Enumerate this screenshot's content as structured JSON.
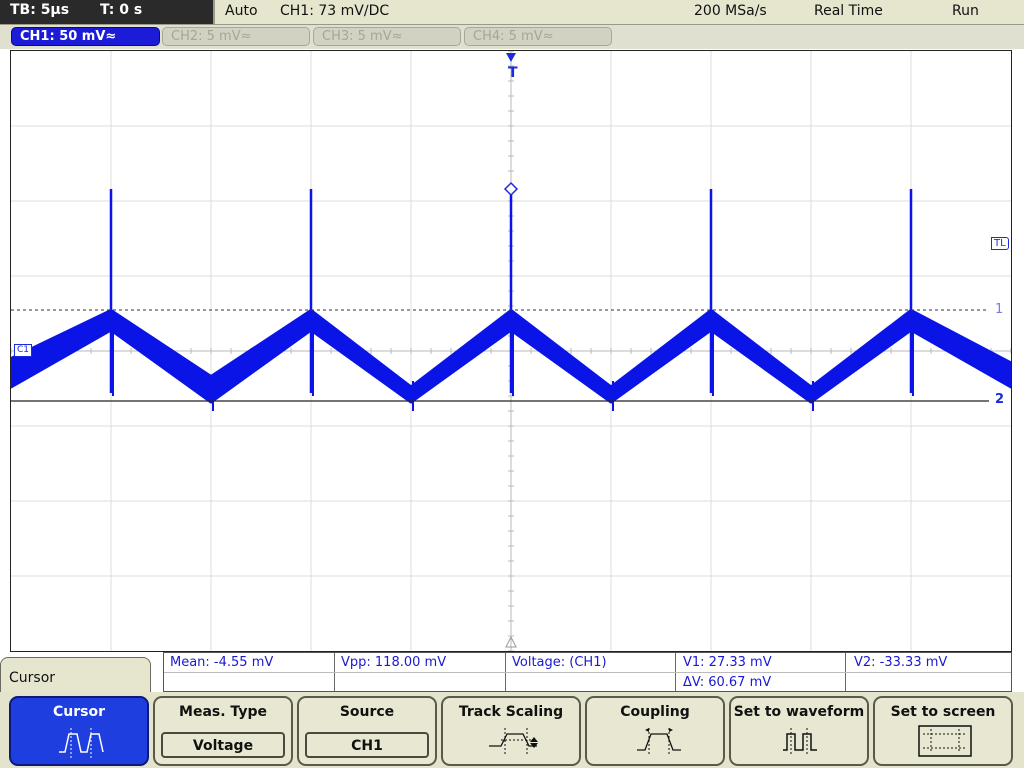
{
  "topbar": {
    "timebase": "TB: 5µs",
    "trigger_time": "T: 0 s",
    "trigger_mode": "Auto",
    "ch1_trigger": "CH1: 73 mV∕DC",
    "sample_rate": "200 MSa/s",
    "acq_mode": "Real Time",
    "run_state": "Run"
  },
  "channels": [
    {
      "label": "CH1: 50 mV≈",
      "active": true
    },
    {
      "label": "CH2: 5 mV≈",
      "active": false
    },
    {
      "label": "CH3: 5 mV≈",
      "active": false
    },
    {
      "label": "CH4: 5 mV≈",
      "active": false
    }
  ],
  "plot": {
    "trigger_marker": "T",
    "trigger_level_label": "TL",
    "channel_marker": "C1",
    "cursor1_label": "1",
    "cursor2_label": "2",
    "trace_color": "#0a14e6"
  },
  "chart_data": {
    "type": "line",
    "description_units": {
      "x": "µs",
      "y": "mV"
    },
    "xlim": [
      -25,
      25
    ],
    "ylim": [
      -200,
      200
    ],
    "x": [
      -25,
      -20,
      -15,
      -10,
      -5,
      0,
      5,
      10,
      15,
      20,
      25
    ],
    "y_upper": [
      -5,
      27,
      -17,
      27,
      -24,
      27,
      -24,
      27,
      -24,
      27,
      -8
    ],
    "y_lower": [
      -24,
      14,
      -34,
      14,
      -34,
      14,
      -34,
      14,
      -34,
      14,
      -24
    ],
    "spike_peak_mV": 108,
    "spike_times_us": [
      -20,
      -10,
      0,
      10,
      20
    ]
  },
  "measurements": {
    "mean": "Mean: -4.55 mV",
    "vpp": "Vpp: 118.00 mV",
    "voltage": "Voltage:  (CH1)",
    "v1": "V1: 27.33 mV",
    "v2": "V2: -33.33 mV",
    "dv": "ΔV: 60.67 mV"
  },
  "menu": {
    "title": "Cursor",
    "softkeys": [
      {
        "label": "Cursor",
        "selected": true
      },
      {
        "label": "Meas. Type",
        "value": "Voltage"
      },
      {
        "label": "Source",
        "value": "CH1"
      },
      {
        "label": "Track Scaling"
      },
      {
        "label": "Coupling"
      },
      {
        "label": "Set to waveform"
      },
      {
        "label": "Set to screen"
      }
    ]
  }
}
